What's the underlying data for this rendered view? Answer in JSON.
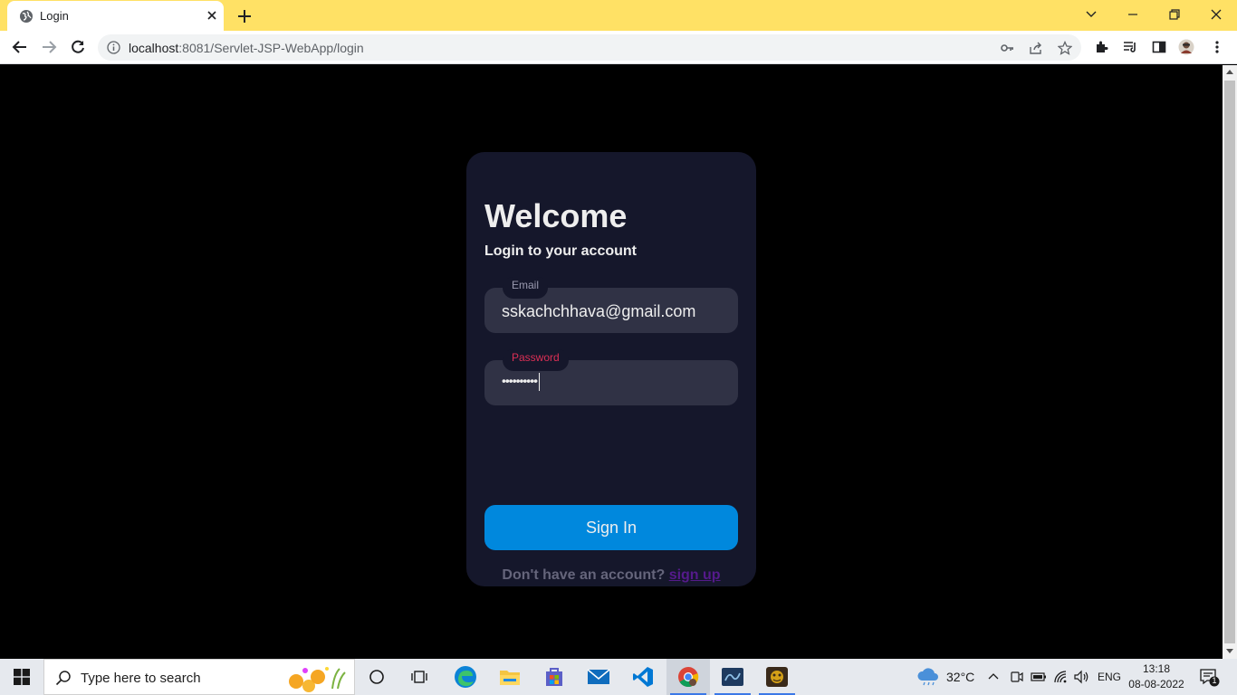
{
  "browser": {
    "tab_title": "Login",
    "url_host": "localhost",
    "url_rest": ":8081/Servlet-JSP-WebApp/login"
  },
  "page": {
    "heading": "Welcome",
    "subheading": "Login to your account",
    "email_label": "Email",
    "email_value": "sskachchhava@gmail.com",
    "password_label": "Password",
    "password_value": "••••••••••",
    "signin_label": "Sign In",
    "no_account_text": "Don't have an account? ",
    "signup_link": "sign up",
    "colors": {
      "card": "#15172b",
      "field": "#303245",
      "button": "#0088dd",
      "password_label": "#dc2f55",
      "email_label": "#9a9aaf",
      "link": "#551a8b"
    }
  },
  "taskbar": {
    "search_placeholder": "Type here to search",
    "weather": "32°C",
    "language": "ENG",
    "time": "13:18",
    "date": "08-08-2022",
    "notification_count": "1"
  }
}
